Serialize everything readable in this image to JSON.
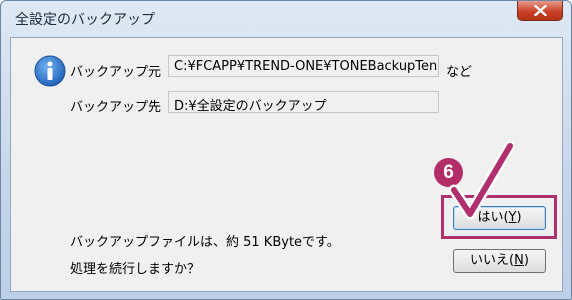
{
  "window": {
    "title": "全設定のバックアップ"
  },
  "source": {
    "label": "バックアップ元",
    "value": "C:¥FCAPP¥TREND-ONE¥TONEBackupTen",
    "suffix": "など"
  },
  "destination": {
    "label": "バックアップ先",
    "value": "D:¥全設定のバックアップ"
  },
  "message": {
    "size_text": "バックアップファイルは、約 51 KByteです。",
    "question": "処理を続行しますか？"
  },
  "buttons": {
    "yes_main": "はい(",
    "yes_key": "Y",
    "yes_end": ")",
    "no_main": "いいえ(",
    "no_key": "N",
    "no_end": ")"
  },
  "annotation": {
    "step_number": "6",
    "color": "#b0306e"
  },
  "icons": {
    "info": "info-icon",
    "close": "close-icon",
    "check": "checkmark-icon"
  }
}
